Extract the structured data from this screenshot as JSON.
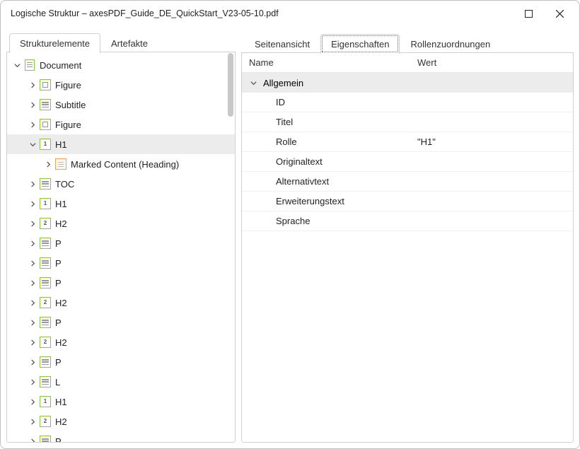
{
  "window": {
    "title": "Logische Struktur – axesPDF_Guide_DE_QuickStart_V23-05-10.pdf"
  },
  "leftPane": {
    "tabs": [
      {
        "label": "Strukturelemente",
        "active": true
      },
      {
        "label": "Artefakte",
        "active": false
      }
    ],
    "tree": [
      {
        "level": 0,
        "expanded": true,
        "icon": "doc",
        "label": "Document",
        "selected": false
      },
      {
        "level": 1,
        "expanded": false,
        "hasChildren": true,
        "icon": "fig",
        "label": "Figure"
      },
      {
        "level": 1,
        "expanded": false,
        "hasChildren": true,
        "icon": "txt",
        "label": "Subtitle"
      },
      {
        "level": 1,
        "expanded": false,
        "hasChildren": true,
        "icon": "fig",
        "label": "Figure"
      },
      {
        "level": 1,
        "expanded": true,
        "hasChildren": true,
        "icon": "h1",
        "label": "H1",
        "selected": true
      },
      {
        "level": 2,
        "expanded": false,
        "hasChildren": true,
        "icon": "mc",
        "label": "Marked Content (Heading)"
      },
      {
        "level": 1,
        "expanded": false,
        "hasChildren": true,
        "icon": "txt",
        "label": "TOC"
      },
      {
        "level": 1,
        "expanded": false,
        "hasChildren": true,
        "icon": "h1",
        "label": "H1"
      },
      {
        "level": 1,
        "expanded": false,
        "hasChildren": true,
        "icon": "h2",
        "label": "H2"
      },
      {
        "level": 1,
        "expanded": false,
        "hasChildren": true,
        "icon": "txt",
        "label": "P"
      },
      {
        "level": 1,
        "expanded": false,
        "hasChildren": true,
        "icon": "txt",
        "label": "P"
      },
      {
        "level": 1,
        "expanded": false,
        "hasChildren": true,
        "icon": "txt",
        "label": "P"
      },
      {
        "level": 1,
        "expanded": false,
        "hasChildren": true,
        "icon": "h2",
        "label": "H2"
      },
      {
        "level": 1,
        "expanded": false,
        "hasChildren": true,
        "icon": "txt",
        "label": "P"
      },
      {
        "level": 1,
        "expanded": false,
        "hasChildren": true,
        "icon": "h2",
        "label": "H2"
      },
      {
        "level": 1,
        "expanded": false,
        "hasChildren": true,
        "icon": "txt",
        "label": "P"
      },
      {
        "level": 1,
        "expanded": false,
        "hasChildren": true,
        "icon": "txt",
        "label": "L"
      },
      {
        "level": 1,
        "expanded": false,
        "hasChildren": true,
        "icon": "h1",
        "label": "H1"
      },
      {
        "level": 1,
        "expanded": false,
        "hasChildren": true,
        "icon": "h2",
        "label": "H2"
      },
      {
        "level": 1,
        "expanded": false,
        "hasChildren": true,
        "icon": "txt",
        "label": "P"
      }
    ]
  },
  "rightPane": {
    "tabs": [
      {
        "label": "Seitenansicht",
        "active": false
      },
      {
        "label": "Eigenschaften",
        "active": true,
        "dotted": true
      },
      {
        "label": "Rollenzuordnungen",
        "active": false
      }
    ],
    "columns": {
      "name": "Name",
      "value": "Wert"
    },
    "group": {
      "label": "Allgemein",
      "expanded": true
    },
    "props": [
      {
        "name": "ID",
        "value": ""
      },
      {
        "name": "Titel",
        "value": ""
      },
      {
        "name": "Rolle",
        "value": "\"H1\""
      },
      {
        "name": "Originaltext",
        "value": ""
      },
      {
        "name": "Alternativtext",
        "value": ""
      },
      {
        "name": "Erweiterungstext",
        "value": ""
      },
      {
        "name": "Sprache",
        "value": ""
      }
    ]
  }
}
